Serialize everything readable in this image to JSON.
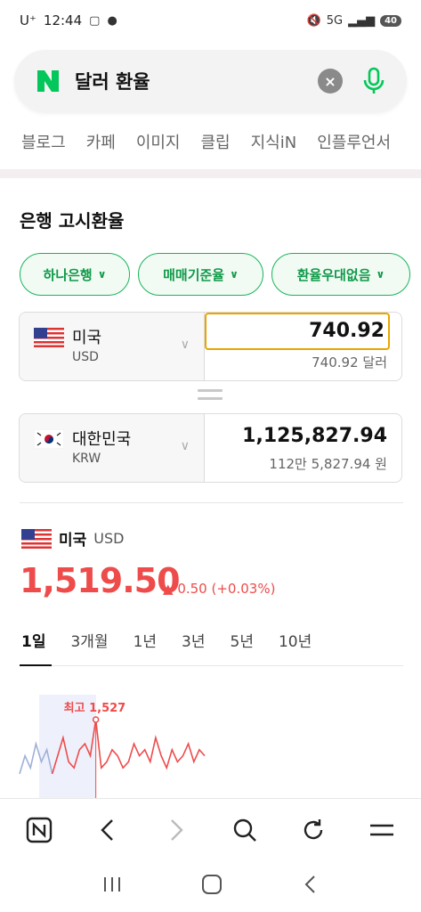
{
  "status_bar": {
    "carrier": "U⁺",
    "time": "12:44",
    "network": "5G",
    "battery": "40"
  },
  "search": {
    "query": "달러 환율",
    "logo": "N"
  },
  "categories": [
    "블로그",
    "카페",
    "이미지",
    "클립",
    "지식iN",
    "인플루언서"
  ],
  "section_title": "은행 고시환율",
  "chips": [
    {
      "label": "하나은행"
    },
    {
      "label": "매매기준율"
    },
    {
      "label": "환율우대없음"
    }
  ],
  "converter": {
    "from": {
      "name": "미국",
      "code": "USD",
      "value": "740.92",
      "sub": "740.92 달러"
    },
    "to": {
      "name": "대한민국",
      "code": "KRW",
      "value": "1,125,827.94",
      "sub": "112만 5,827.94 원"
    }
  },
  "rate": {
    "name": "미국",
    "code": "USD",
    "value": "1,519.50",
    "change": "0.50 (+0.03%)",
    "change_direction": "up",
    "accent": "#ee4b4b"
  },
  "periods": [
    "1일",
    "3개월",
    "1년",
    "3년",
    "5년",
    "10년"
  ],
  "chart_data": {
    "type": "line",
    "annotation": "최고 1,527",
    "series": [
      {
        "values": [
          1518,
          1521,
          1519,
          1523,
          1520,
          1522,
          1518,
          1521,
          1524,
          1520,
          1519,
          1522,
          1523,
          1521,
          1527,
          1519,
          1520,
          1522,
          1521,
          1519,
          1520,
          1523,
          1521,
          1522,
          1520,
          1524,
          1521,
          1519,
          1522,
          1520,
          1521,
          1523,
          1520,
          1522,
          1521
        ]
      }
    ]
  },
  "colors": {
    "brand_green": "#03c75a",
    "chip_green": "#0f9a48",
    "input_border": "#e8a500"
  }
}
